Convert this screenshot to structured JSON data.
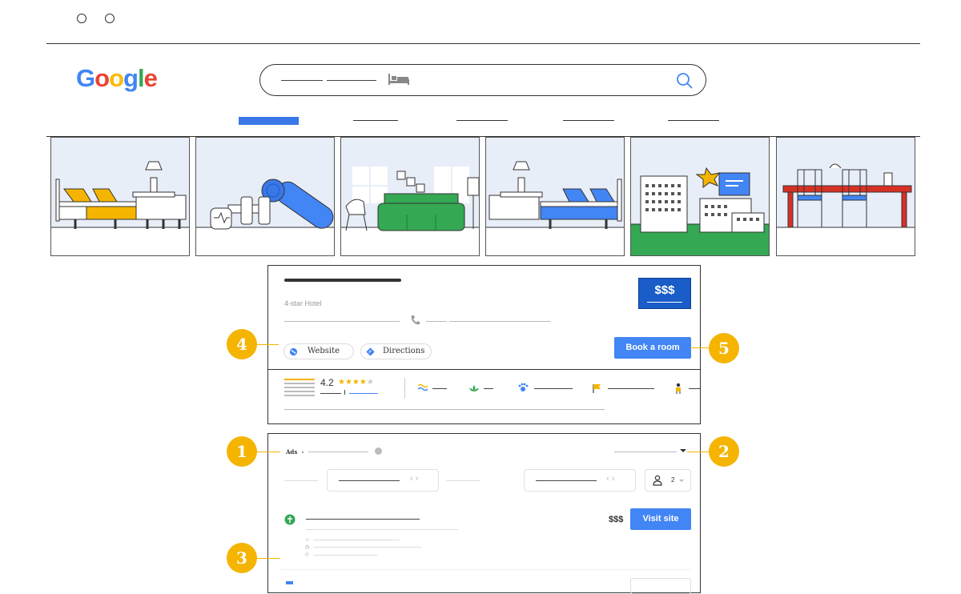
{
  "browser": {
    "controls": [
      "window-dot",
      "window-dot"
    ]
  },
  "logo": {
    "letters": [
      "G",
      "o",
      "o",
      "g",
      "l",
      "e"
    ],
    "colors": [
      "#4285f4",
      "#ea4335",
      "#fbbc05",
      "#4285f4",
      "#34a853",
      "#ea4335"
    ]
  },
  "hotel_card": {
    "subtitle": "4-star Hotel",
    "price": "$$$",
    "website_label": "Website",
    "directions_label": "Directions",
    "book_label": "Book a room",
    "rating": "4.2",
    "stars": "★★★★",
    "star_empty": "★"
  },
  "ads_panel": {
    "ads_label": "Ads",
    "guests": "2",
    "ad_price": "$$$",
    "visit_label": "Visit site"
  },
  "callouts": [
    "1",
    "2",
    "3",
    "4",
    "5"
  ],
  "colors": {
    "accent_blue": "#4285f4",
    "callout": "#f5b400",
    "price_bg": "#1a5cc8"
  }
}
